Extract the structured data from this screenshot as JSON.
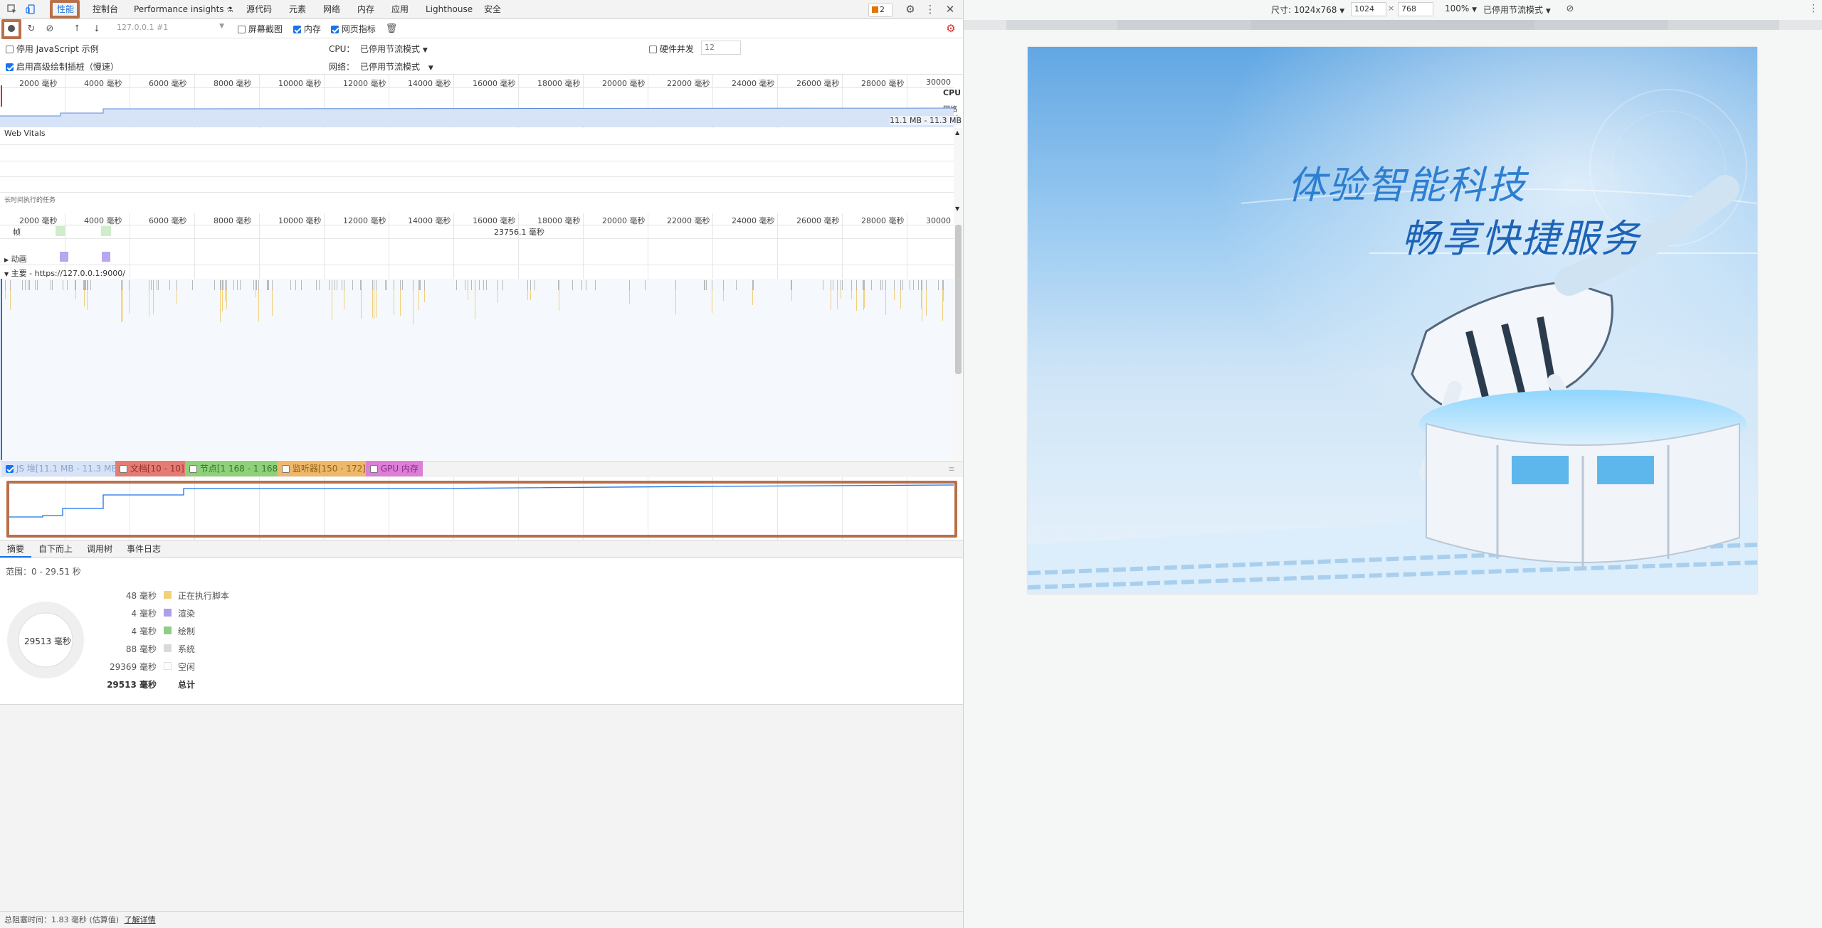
{
  "tabs": [
    {
      "label": "性能",
      "active": true
    },
    {
      "label": "控制台"
    },
    {
      "label": "Performance insights"
    },
    {
      "label": "源代码"
    },
    {
      "label": "元素"
    },
    {
      "label": "网络"
    },
    {
      "label": "内存"
    },
    {
      "label": "应用"
    },
    {
      "label": "Lighthouse"
    },
    {
      "label": "安全"
    }
  ],
  "issues_count": "2",
  "toolbar": {
    "url_select": "127.0.0.1 #1",
    "screenshots_label": "屏幕截图",
    "memory_label": "内存",
    "web_vitals_label": "网页指标"
  },
  "settings": {
    "disable_js_samples": "停用 JavaScript 示例",
    "advanced_paint": "启用高级绘制插桩（慢速）",
    "cpu_label": "CPU：",
    "cpu_value": "已停用节流模式",
    "network_label": "网络：",
    "network_value": "已停用节流模式",
    "hw_concurrency": "硬件并发",
    "hw_value": "12"
  },
  "overview": {
    "ticks": [
      "2000 毫秒",
      "4000 毫秒",
      "6000 毫秒",
      "8000 毫秒",
      "10000 毫秒",
      "12000 毫秒",
      "14000 毫秒",
      "16000 毫秒",
      "18000 毫秒",
      "20000 毫秒",
      "22000 毫秒",
      "24000 毫秒",
      "26000 毫秒",
      "28000 毫秒",
      "30000"
    ],
    "cpu_label": "CPU",
    "net_label": "网络",
    "heap_label": "堆",
    "heap_range": "11.1 MB - 11.3 MB"
  },
  "web_vitals": {
    "title": "Web Vitals",
    "long_tasks": "长时间执行的任务"
  },
  "flame": {
    "ticks": [
      "2000 毫秒",
      "4000 毫秒",
      "6000 毫秒",
      "8000 毫秒",
      "10000 毫秒",
      "12000 毫秒",
      "14000 毫秒",
      "16000 毫秒",
      "18000 毫秒",
      "20000 毫秒",
      "22000 毫秒",
      "24000 毫秒",
      "26000 毫秒",
      "28000 毫秒",
      "30000 毫秒"
    ],
    "frames_label": "帧",
    "frame_marker": "23756.1 毫秒",
    "animation_label": "动画",
    "main_label": "主要 - https://127.0.0.1:9000/"
  },
  "counters": [
    {
      "label": "JS 堆[11.1 MB - 11.3 MB]",
      "checked": true,
      "color": "#d7e3f7"
    },
    {
      "label": "文档[10 - 10]",
      "checked": false,
      "color": "#e27c74"
    },
    {
      "label": "节点[1 168 - 1 168]",
      "checked": false,
      "color": "#8fd07a"
    },
    {
      "label": "监听器[150 - 172]",
      "checked": false,
      "color": "#eeb86a"
    },
    {
      "label": "GPU 内存",
      "checked": false,
      "color": "#dc7fd8"
    }
  ],
  "bottom_tabs": [
    "摘要",
    "自下而上",
    "调用树",
    "事件日志"
  ],
  "summary": {
    "range": "范围：0 - 29.51 秒",
    "donut_total": "29513 毫秒",
    "rows": [
      {
        "value": "48 毫秒",
        "label": "正在执行脚本",
        "color": "#f2d07a"
      },
      {
        "value": "4 毫秒",
        "label": "渲染",
        "color": "#af9ee8"
      },
      {
        "value": "4 毫秒",
        "label": "绘制",
        "color": "#8fcf85"
      },
      {
        "value": "88 毫秒",
        "label": "系统",
        "color": "#dadada"
      },
      {
        "value": "29369 毫秒",
        "label": "空闲",
        "color": "#ffffff"
      }
    ],
    "total_value": "29513 毫秒",
    "total_label": "总计"
  },
  "status_bar": {
    "text": "总阻塞时间：1.83 毫秒 (估算值)",
    "link": "了解详情"
  },
  "device_toolbar": {
    "dimensions": "尺寸: 1024x768",
    "width": "1024",
    "times": "×",
    "height": "768",
    "zoom": "100%",
    "throttle": "已停用节流模式"
  },
  "banner": {
    "line1": "体验智能科技",
    "line2": "畅享快捷服务"
  }
}
